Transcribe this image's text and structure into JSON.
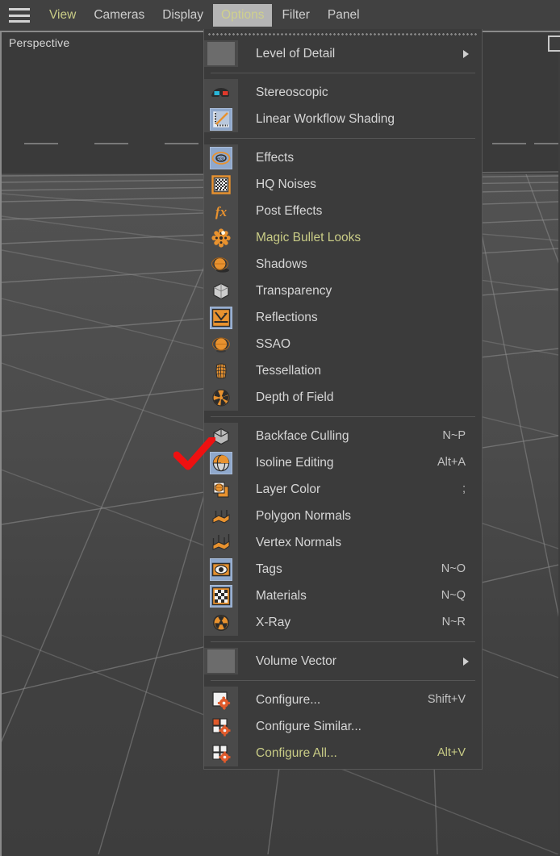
{
  "app": {
    "menubar": {
      "hamburger_icon": "hamburger-icon",
      "items": [
        {
          "label": "View",
          "state": "accent"
        },
        {
          "label": "Cameras",
          "state": "normal"
        },
        {
          "label": "Display",
          "state": "normal"
        },
        {
          "label": "Options",
          "state": "active"
        },
        {
          "label": "Filter",
          "state": "normal"
        },
        {
          "label": "Panel",
          "state": "normal"
        }
      ]
    },
    "viewport": {
      "label": "Perspective",
      "corner_icon": "viewport-layout-icon",
      "background_color": "#3d3d3d",
      "grid_color": "#8f8f8f"
    },
    "dropdown": {
      "owner": "Options",
      "tearoff_handle": "tearoff-dots",
      "groups": [
        {
          "items": [
            {
              "label": "Level of Detail",
              "shortcut": "",
              "icon": "blank-swatch-icon",
              "submenu": true,
              "selected": false,
              "accent": false
            }
          ]
        },
        {
          "items": [
            {
              "label": "Stereoscopic",
              "shortcut": "",
              "icon": "stereoscopic-glasses-icon",
              "submenu": false,
              "selected": false,
              "accent": false
            },
            {
              "label": "Linear Workflow Shading",
              "shortcut": "",
              "icon": "linear-workflow-graph-icon",
              "submenu": false,
              "selected": true,
              "accent": false
            }
          ]
        },
        {
          "items": [
            {
              "label": "Effects",
              "shortcut": "",
              "icon": "opengl-effects-icon",
              "submenu": false,
              "selected": true,
              "accent": false
            },
            {
              "label": "HQ Noises",
              "shortcut": "",
              "icon": "hq-noises-icon",
              "submenu": false,
              "selected": false,
              "accent": false
            },
            {
              "label": "Post Effects",
              "shortcut": "",
              "icon": "fx-post-effects-icon",
              "submenu": false,
              "selected": false,
              "accent": false
            },
            {
              "label": "Magic Bullet Looks",
              "shortcut": "",
              "icon": "magic-bullet-looks-icon",
              "submenu": false,
              "selected": false,
              "accent": true
            },
            {
              "label": "Shadows",
              "shortcut": "",
              "icon": "shadows-sphere-icon",
              "submenu": false,
              "selected": false,
              "accent": false
            },
            {
              "label": "Transparency",
              "shortcut": "",
              "icon": "transparency-cube-icon",
              "submenu": false,
              "selected": false,
              "accent": false
            },
            {
              "label": "Reflections",
              "shortcut": "",
              "icon": "reflections-arrow-icon",
              "submenu": false,
              "selected": true,
              "accent": false
            },
            {
              "label": "SSAO",
              "shortcut": "",
              "icon": "ssao-sphere-icon",
              "submenu": false,
              "selected": false,
              "accent": false
            },
            {
              "label": "Tessellation",
              "shortcut": "",
              "icon": "tessellation-mesh-icon",
              "submenu": false,
              "selected": false,
              "accent": false
            },
            {
              "label": "Depth of Field",
              "shortcut": "",
              "icon": "depth-of-field-aperture-icon",
              "submenu": false,
              "selected": false,
              "accent": false
            }
          ]
        },
        {
          "items": [
            {
              "label": "Backface Culling",
              "shortcut": "N~P",
              "icon": "backface-culling-cube-icon",
              "submenu": false,
              "selected": false,
              "accent": false
            },
            {
              "label": "Isoline Editing",
              "shortcut": "Alt+A",
              "icon": "isoline-editing-sphere-icon",
              "submenu": false,
              "selected": true,
              "accent": false
            },
            {
              "label": "Layer Color",
              "shortcut": ";",
              "icon": "layer-color-icon",
              "submenu": false,
              "selected": false,
              "accent": false
            },
            {
              "label": "Polygon Normals",
              "shortcut": "",
              "icon": "polygon-normals-icon",
              "submenu": false,
              "selected": false,
              "accent": false
            },
            {
              "label": "Vertex Normals",
              "shortcut": "",
              "icon": "vertex-normals-icon",
              "submenu": false,
              "selected": false,
              "accent": false
            },
            {
              "label": "Tags",
              "shortcut": "N~O",
              "icon": "tags-eye-icon",
              "submenu": false,
              "selected": true,
              "accent": false
            },
            {
              "label": "Materials",
              "shortcut": "N~Q",
              "icon": "materials-checker-icon",
              "submenu": false,
              "selected": true,
              "accent": false
            },
            {
              "label": "X-Ray",
              "shortcut": "N~R",
              "icon": "xray-radiation-icon",
              "submenu": false,
              "selected": false,
              "accent": false
            }
          ]
        },
        {
          "items": [
            {
              "label": "Volume Vector",
              "shortcut": "",
              "icon": "blank-swatch-icon",
              "submenu": true,
              "selected": false,
              "accent": false
            }
          ]
        },
        {
          "items": [
            {
              "label": "Configure...",
              "shortcut": "Shift+V",
              "icon": "configure-gear-icon",
              "submenu": false,
              "selected": false,
              "accent": false
            },
            {
              "label": "Configure Similar...",
              "shortcut": "",
              "icon": "configure-similar-gear-icon",
              "submenu": false,
              "selected": false,
              "accent": false
            },
            {
              "label": "Configure All...",
              "shortcut": "Alt+V",
              "icon": "configure-all-gear-icon",
              "submenu": false,
              "selected": false,
              "accent": true
            }
          ]
        }
      ]
    },
    "annotation": {
      "type": "red-check-mark",
      "color": "#ee1111",
      "points_at": "Isoline Editing"
    },
    "colors": {
      "accent_text": "#c9cc86",
      "menu_bg": "#3b3b3b",
      "icon_cell_bg": "#4a4a4a",
      "selected_tile": "#8fa8cc",
      "orange": "#e8922f",
      "annotation_red": "#ee1111"
    }
  }
}
